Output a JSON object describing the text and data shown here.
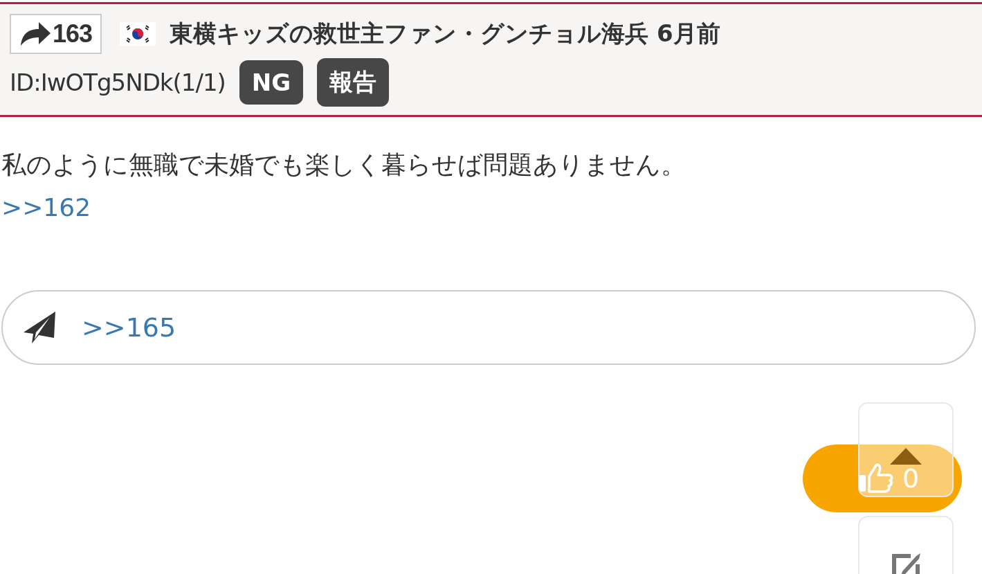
{
  "post": {
    "reply_count": "163",
    "author": "東横キッズの救世主ファン・グンチョル海兵",
    "time": "6月前",
    "id": "ID:IwOTg5NDk(1/1)",
    "buttons": [
      "NG",
      "報告"
    ]
  },
  "body": {
    "text": "私のように無職で未婚でも楽しく暮らせば問題ありません。",
    "anchor": ">>162"
  },
  "reply": {
    "value": ">>165"
  },
  "like": {
    "count": "0"
  }
}
